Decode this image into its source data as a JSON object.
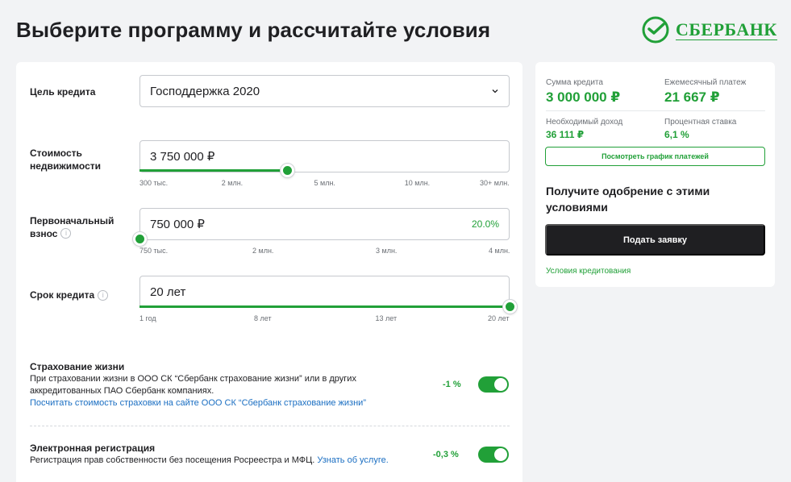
{
  "page": {
    "title": "Выберите программу и рассчитайте условия"
  },
  "logo": {
    "text": "СБЕРБАНК"
  },
  "form": {
    "goal": {
      "label": "Цель кредита",
      "value": "Господдержка 2020"
    },
    "price": {
      "label_l1": "Стоимость",
      "label_l2": "недвижимости",
      "value": "3 750 000 ₽",
      "fraction": 0.398,
      "ticks": [
        "300 тыс.",
        "2 млн.",
        "5 млн.",
        "10 млн.",
        "30+ млн."
      ]
    },
    "down": {
      "label_l1": "Первоначальный",
      "label_l2": "взнос",
      "value": "750 000 ₽",
      "percent": "20.0%",
      "fraction": 0.0,
      "ticks": [
        "750 тыс.",
        "2 млн.",
        "3 млн.",
        "4 млн."
      ]
    },
    "term": {
      "label": "Срок кредита",
      "value": "20 лет",
      "fraction": 1.0,
      "ticks": [
        "1 год",
        "8 лет",
        "13 лет",
        "20 лет"
      ]
    },
    "life_insurance": {
      "title": "Страхование жизни",
      "desc": "При страховании жизни в ООО СК “Сбербанк страхование жизни” или в других аккредитованных ПАО Сбербанк компаниях.",
      "link": "Посчитать стоимость страховки на сайте ООО СК “Сбербанк страхование жизни”",
      "discount": "-1 %",
      "enabled": true
    },
    "e_registration": {
      "title": "Электронная регистрация",
      "desc": "Регистрация прав собственности без посещения Росреестра и МФЦ.",
      "link": "Узнать об услуге.",
      "discount": "-0,3 %",
      "enabled": true
    },
    "info_glyph": "i"
  },
  "summary": {
    "loan_amount_label": "Сумма кредита",
    "loan_amount": "3 000 000 ₽",
    "monthly_label": "Ежемесячный платеж",
    "monthly": "21 667 ₽",
    "income_label": "Необходимый доход",
    "income": "36 111 ₽",
    "rate_label": "Процентная ставка",
    "rate": "6,1 %",
    "schedule_button": "Посмотреть график платежей",
    "approval_text": "Получите одобрение с этими условиями",
    "apply_button": "Подать заявку",
    "terms_link": "Условия кредитования"
  },
  "colors": {
    "accent": "#21a038",
    "dark": "#1f1f22",
    "link": "#1a6ec2"
  },
  "icons": [
    "sberbank-logo-icon",
    "chevron-down-icon",
    "info-icon"
  ]
}
